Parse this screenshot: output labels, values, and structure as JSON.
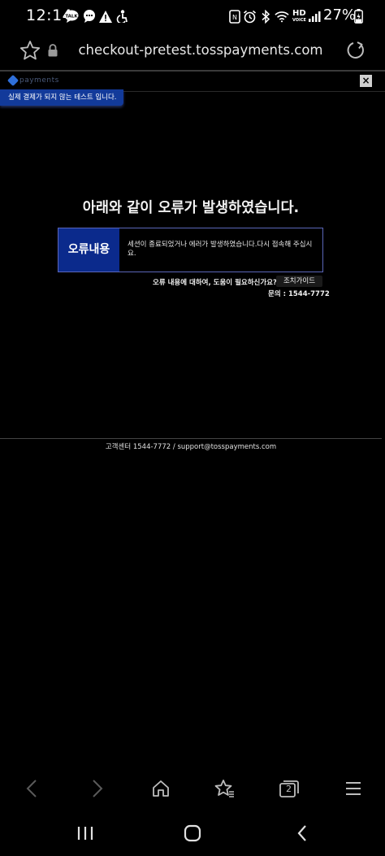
{
  "status_bar": {
    "time": "12:14",
    "notification_icons": [
      "talk-icon",
      "chat-bubble-icon",
      "warning-icon",
      "accessibility-icon"
    ],
    "system_icons": [
      "nfc-icon",
      "alarm-icon",
      "bluetooth-icon",
      "wifi-icon",
      "hd-voice-icon",
      "signal-icon"
    ],
    "hd_label": "HD",
    "voice_label": "VOICE",
    "battery_text": "27%"
  },
  "url_bar": {
    "url": "checkout-pretest.tosspayments.com"
  },
  "page": {
    "brand_text": "payments",
    "close_label": "×",
    "test_notice": "실제 결제가 되지 않는 테스트 입니다.",
    "error_title": "아래와 같이 오류가 발생하였습니다.",
    "error_label": "오류내용",
    "error_message": "세션이 종료되었거나 에러가 발생하였습니다.다시 접속해 주십시요.",
    "help_text": "오류 내용에 대하여, 도움이 필요하신가요?",
    "guide_button": "조치가이드",
    "contact_text": "문의 : 1544-7772",
    "footer_text": "고객센터 1544-7772 / support@tosspayments.com"
  },
  "toolbar": {
    "tabs_count": "2"
  },
  "colors": {
    "background": "#000000",
    "accent_blue": "#0b2a8c",
    "badge_blue": "#123a9a",
    "box_border": "#5a66b8"
  }
}
